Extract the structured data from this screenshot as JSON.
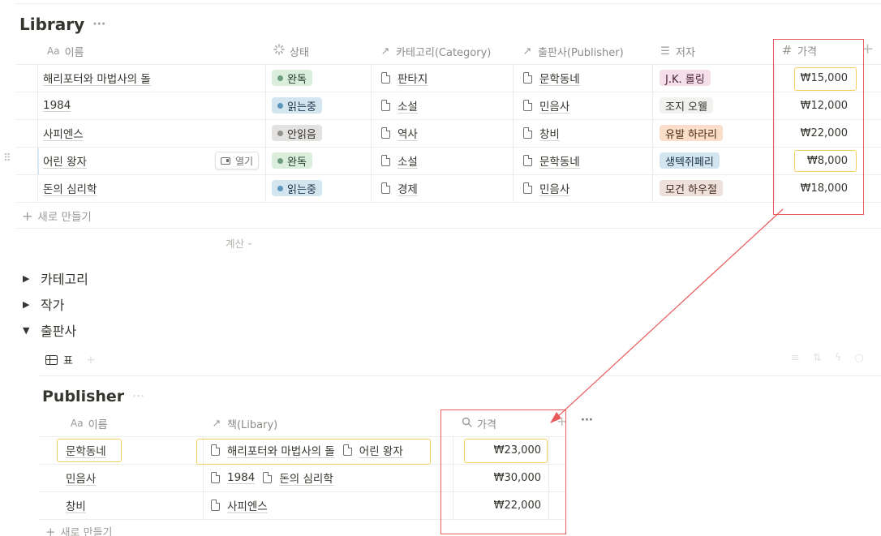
{
  "library": {
    "title": "Library",
    "more": "···",
    "columns": {
      "name": "이름",
      "status": "상태",
      "category": "카테고리(Category)",
      "publisher": "출판사(Publisher)",
      "author": "저자",
      "price": "가격"
    },
    "col_prefix": {
      "name": "Aa"
    },
    "rows": [
      {
        "name": "해리포터와 마법사의 돌",
        "status": "완독",
        "category": "판타지",
        "publisher": "문학동네",
        "author": "J.K. 롤링",
        "price": "₩15,000"
      },
      {
        "name": "1984",
        "status": "읽는중",
        "category": "소설",
        "publisher": "민음사",
        "author": "조지 오웰",
        "price": "₩12,000"
      },
      {
        "name": "사피엔스",
        "status": "안읽음",
        "category": "역사",
        "publisher": "창비",
        "author": "유발 하라리",
        "price": "₩22,000"
      },
      {
        "name": "어린 왕자",
        "status": "완독",
        "category": "소설",
        "publisher": "문학동네",
        "author": "생텍쥐페리",
        "price": "₩8,000",
        "open_label": "열기"
      },
      {
        "name": "돈의 심리학",
        "status": "읽는중",
        "category": "경제",
        "publisher": "민음사",
        "author": "모건 하우절",
        "price": "₩18,000"
      }
    ],
    "new_label": "새로 만들기",
    "calc_label": "계산"
  },
  "toggles": [
    {
      "label": "카테고리",
      "open": false
    },
    {
      "label": "작가",
      "open": false
    },
    {
      "label": "출판사",
      "open": true
    }
  ],
  "view_tab": {
    "label": "표"
  },
  "publisher": {
    "title": "Publisher",
    "more": "···",
    "columns": {
      "name": "이름",
      "books": "책(Libary)",
      "price": "가격"
    },
    "col_prefix": {
      "name": "Aa"
    },
    "rows": [
      {
        "name": "문학동네",
        "books": [
          "해리포터와 마법사의 돌",
          "어린 왕자"
        ],
        "price": "₩23,000"
      },
      {
        "name": "민음사",
        "books": [
          "1984",
          "돈의 심리학"
        ],
        "price": "₩30,000"
      },
      {
        "name": "창비",
        "books": [
          "사피엔스"
        ],
        "price": "₩22,000"
      }
    ],
    "new_label": "새로 만들기",
    "col_more": "···"
  },
  "colors": {
    "status_done_bg": "#dbeddb",
    "status_done_dot": "#6c9b7d",
    "status_reading_bg": "#d3e5ef",
    "status_reading_dot": "#5b97bd",
    "status_unread_bg": "#e3e2e0",
    "status_unread_dot": "#91918e",
    "author_pink": "#f5e0e9",
    "author_gray": "#f1f1ef",
    "author_orange": "#fadec9",
    "author_blue": "#d3e5ef",
    "author_brown": "#eee0da",
    "annotation_red": "#ea5a5a",
    "annotation_yellow": "#f5d05f"
  }
}
